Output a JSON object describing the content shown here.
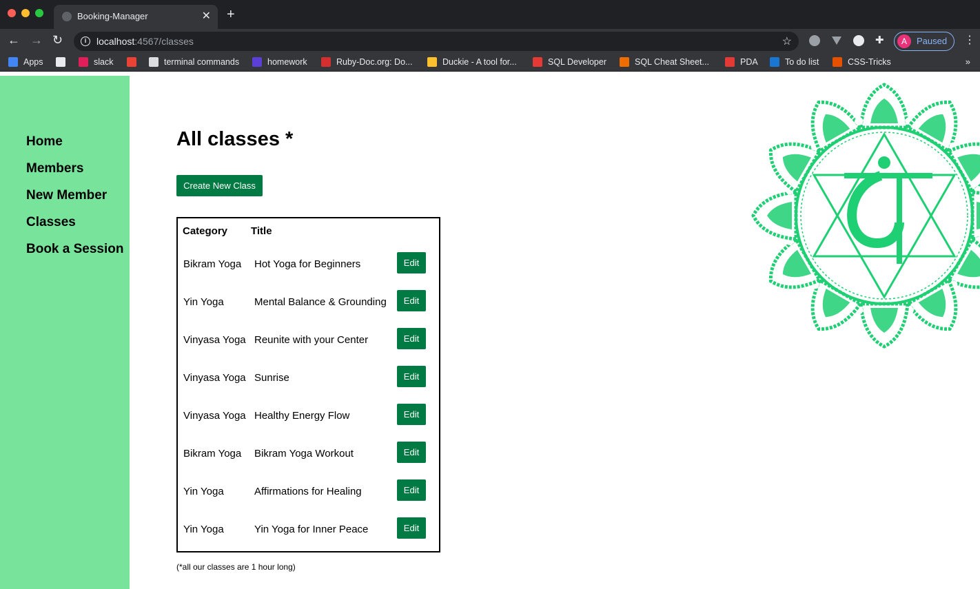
{
  "browser": {
    "tab_title": "Booking-Manager",
    "new_tab": "+",
    "close_tab": "✕",
    "url_host": "localhost",
    "url_path": ":4567/classes",
    "profile_initial": "A",
    "profile_status": "Paused",
    "bookmarks": [
      {
        "label": "Apps",
        "color": "#4285f4"
      },
      {
        "label": "",
        "color": "#e8eaed"
      },
      {
        "label": "slack",
        "color": "#e01e5a"
      },
      {
        "label": "",
        "color": "#ea4335"
      },
      {
        "label": "terminal commands",
        "color": "#dadce0"
      },
      {
        "label": "homework",
        "color": "#5b3fd6"
      },
      {
        "label": "Ruby-Doc.org: Do...",
        "color": "#d32f2f"
      },
      {
        "label": "Duckie - A tool for...",
        "color": "#fbc02d"
      },
      {
        "label": "SQL Developer",
        "color": "#e53935"
      },
      {
        "label": "SQL Cheat Sheet...",
        "color": "#ef6c00"
      },
      {
        "label": "PDA",
        "color": "#e53935"
      },
      {
        "label": "To do list",
        "color": "#1976d2"
      },
      {
        "label": "CSS-Tricks",
        "color": "#e65100"
      }
    ],
    "more": "»"
  },
  "sidebar": {
    "items": [
      "Home",
      "Members",
      "New Member",
      "Classes",
      "Book a Session"
    ]
  },
  "main": {
    "title": "All classes *",
    "create_button": "Create New Class",
    "table": {
      "headers": [
        "Category",
        "Title"
      ],
      "edit_label": "Edit",
      "rows": [
        {
          "category": "Bikram Yoga",
          "title": "Hot Yoga for Beginners"
        },
        {
          "category": "Yin Yoga",
          "title": "Mental Balance & Grounding"
        },
        {
          "category": "Vinyasa Yoga",
          "title": "Reunite with your Center"
        },
        {
          "category": "Vinyasa Yoga",
          "title": "Sunrise"
        },
        {
          "category": "Vinyasa Yoga",
          "title": "Healthy Energy Flow"
        },
        {
          "category": "Bikram Yoga",
          "title": "Bikram Yoga Workout"
        },
        {
          "category": "Yin Yoga",
          "title": "Affirmations for Healing"
        },
        {
          "category": "Yin Yoga",
          "title": "Yin Yoga for Inner Peace"
        }
      ]
    },
    "footnote": "(*all our classes are 1 hour long)"
  },
  "colors": {
    "sidebar_bg": "#77e39b",
    "button_bg": "#017a43",
    "mandala": "#1fcf73"
  }
}
